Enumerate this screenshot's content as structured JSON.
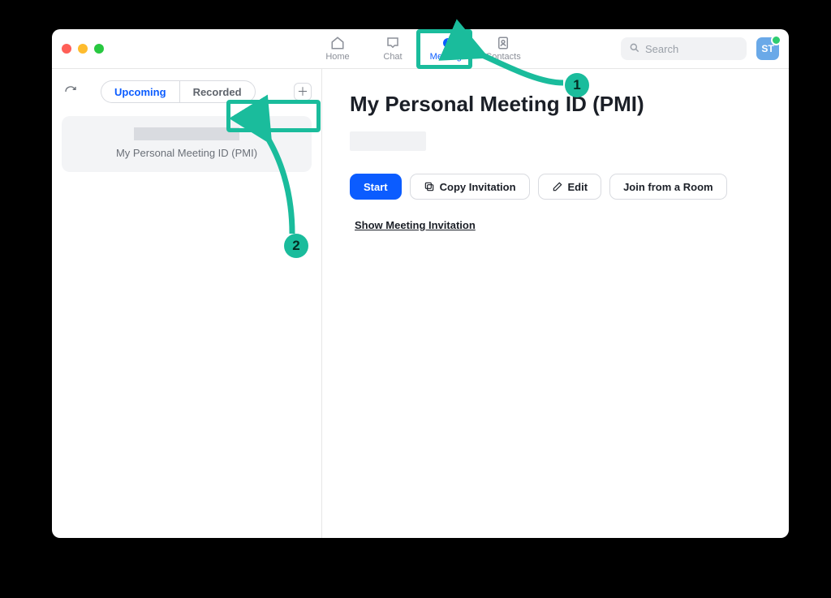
{
  "header": {
    "tabs": {
      "home": "Home",
      "chat": "Chat",
      "meetings": "Meetings",
      "contacts": "Contacts"
    },
    "search_placeholder": "Search",
    "avatar_initials": "ST"
  },
  "sidebar": {
    "segments": {
      "upcoming": "Upcoming",
      "recorded": "Recorded"
    },
    "selected_meeting_label": "My Personal Meeting ID (PMI)"
  },
  "main": {
    "title": "My Personal Meeting ID (PMI)",
    "actions": {
      "start": "Start",
      "copy_invitation": "Copy Invitation",
      "edit": "Edit",
      "join_from_room": "Join from a Room"
    },
    "show_invitation": "Show Meeting Invitation"
  },
  "annotations": {
    "step1": "1",
    "step2": "2"
  }
}
